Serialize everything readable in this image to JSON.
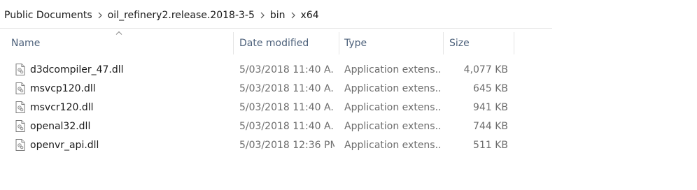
{
  "breadcrumb": {
    "items": [
      {
        "label": "Public Documents"
      },
      {
        "label": "oil_refinery2.release.2018-3-5"
      },
      {
        "label": "bin"
      },
      {
        "label": "x64"
      }
    ]
  },
  "columns": {
    "name": "Name",
    "date_modified": "Date modified",
    "type": "Type",
    "size": "Size",
    "sorted_by": "name",
    "sort_direction": "ascending"
  },
  "files": [
    {
      "name": "d3dcompiler_47.dll",
      "date": "5/03/2018 11:40 A...",
      "type": "Application extens...",
      "size": "4,077 KB",
      "icon": "dll-file-icon"
    },
    {
      "name": "msvcp120.dll",
      "date": "5/03/2018 11:40 A...",
      "type": "Application extens...",
      "size": "645 KB",
      "icon": "dll-file-icon"
    },
    {
      "name": "msvcr120.dll",
      "date": "5/03/2018 11:40 A...",
      "type": "Application extens...",
      "size": "941 KB",
      "icon": "dll-file-icon"
    },
    {
      "name": "openal32.dll",
      "date": "5/03/2018 11:40 A...",
      "type": "Application extens...",
      "size": "744 KB",
      "icon": "dll-file-icon"
    },
    {
      "name": "openvr_api.dll",
      "date": "5/03/2018 12:36 PM",
      "type": "Application extens...",
      "size": "511 KB",
      "icon": "dll-file-icon"
    }
  ],
  "colors": {
    "header_text": "#4c607a",
    "secondary_text": "#6d6d6d",
    "divider": "#e5e5e5"
  }
}
